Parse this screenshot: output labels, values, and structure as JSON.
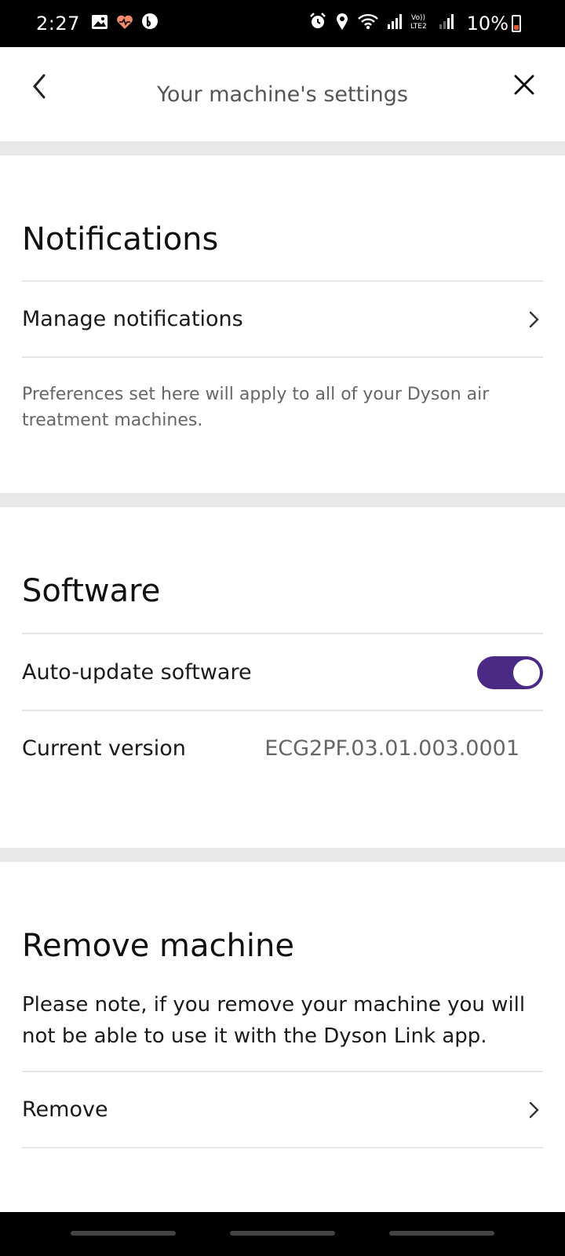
{
  "status_bar": {
    "time": "2:27",
    "battery_percent": "10%",
    "battery_level": 0.1,
    "left_icons": [
      "gallery-icon",
      "heart-icon",
      "b-app-icon"
    ],
    "right_icons": [
      "alarm-icon",
      "location-icon",
      "wifi-icon",
      "signal-icon",
      "volte-icon",
      "signal-icon"
    ],
    "volte_label": "Vo))\nLTE2"
  },
  "header": {
    "title": "Your machine's settings"
  },
  "notifications": {
    "title": "Notifications",
    "manage_label": "Manage notifications",
    "note": "Preferences set here will apply to all of your Dyson air treatment machines."
  },
  "software": {
    "title": "Software",
    "auto_update_label": "Auto-update software",
    "auto_update_on": true,
    "current_version_label": "Current version",
    "current_version_value": "ECG2PF.03.01.003.0001"
  },
  "remove_machine": {
    "title": "Remove machine",
    "note": "Please note, if you remove your machine you will not be able to use it with the Dyson Link app.",
    "remove_label": "Remove"
  },
  "colors": {
    "accent": "#4b2a86",
    "divider": "#e8e8e8",
    "battery_low": "#e2572c"
  }
}
